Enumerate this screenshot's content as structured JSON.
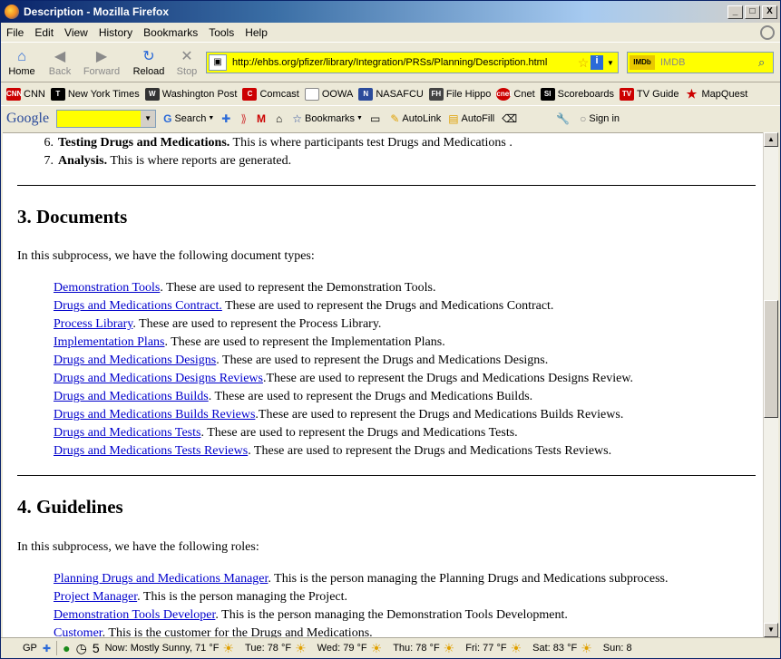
{
  "window": {
    "title": "Description - Mozilla Firefox",
    "min": "_",
    "max": "□",
    "close": "X"
  },
  "menu": [
    "File",
    "Edit",
    "View",
    "History",
    "Bookmarks",
    "Tools",
    "Help"
  ],
  "nav": {
    "back": "Back",
    "forward": "Forward",
    "home": "Home",
    "reload": "Reload",
    "stop": "Stop",
    "url": "http://ehbs.org/pfizer/library/Integration/PRSs/Planning/Description.html",
    "search_placeholder": "IMDB",
    "search_engine": "IMDb"
  },
  "bookmarks": [
    {
      "label": "CNN",
      "icon": "CNN",
      "color": "#cc0000"
    },
    {
      "label": "New York Times",
      "icon": "T",
      "color": "#000000"
    },
    {
      "label": "Washington Post",
      "icon": "W",
      "color": "#333333"
    },
    {
      "label": "Comcast",
      "icon": "C",
      "color": "#cc0000"
    },
    {
      "label": "OOWA",
      "icon": "",
      "color": "#ffffff"
    },
    {
      "label": "NASAFCU",
      "icon": "N",
      "color": "#2b4b9b"
    },
    {
      "label": "File Hippo",
      "icon": "FH",
      "color": "#444444"
    },
    {
      "label": "Cnet",
      "icon": "cnet",
      "color": "#cc0000"
    },
    {
      "label": "Scoreboards",
      "icon": "SI",
      "color": "#000000"
    },
    {
      "label": "TV Guide",
      "icon": "TV",
      "color": "#cc0000"
    },
    {
      "label": "MapQuest",
      "icon": "★",
      "color": "#cc0000"
    }
  ],
  "google_toolbar": {
    "logo": "Google",
    "search": "Search",
    "bookmarks": "Bookmarks",
    "autolink": "AutoLink",
    "autofill": "AutoFill",
    "signin": "Sign in"
  },
  "page": {
    "list_top": [
      {
        "num": "6.",
        "bold": "Testing Drugs and Medications.",
        "text": " This is where participants test Drugs and Medications ."
      },
      {
        "num": "7.",
        "bold": "Analysis.",
        "text": " This is where reports are generated."
      }
    ],
    "documents": {
      "heading": "3. Documents",
      "intro": "In this subprocess, we have the following document types:",
      "items": [
        {
          "link": "Demonstration Tools",
          "text": ". These are used to represent the Demonstration Tools."
        },
        {
          "link": "Drugs and Medications Contract.",
          "text": " These are used to represent the Drugs and Medications Contract."
        },
        {
          "link": "Process Library",
          "text": ". These are used to represent the Process Library."
        },
        {
          "link": "Implementation Plans",
          "text": ". These are used to represent the Implementation Plans."
        },
        {
          "link": "Drugs and Medications Designs",
          "text": ". These are used to represent the Drugs and Medications Designs."
        },
        {
          "link": "Drugs and Medications Designs Reviews",
          "text": ".These are used to represent the Drugs and Medications Designs Review."
        },
        {
          "link": "Drugs and Medications Builds",
          "text": ". These are used to represent the Drugs and Medications Builds."
        },
        {
          "link": "Drugs and Medications Builds Reviews",
          "text": ".These are used to represent the Drugs and Medications Builds Reviews."
        },
        {
          "link": "Drugs and Medications Tests",
          "text": ". These are used to represent the Drugs and Medications Tests."
        },
        {
          "link": "Drugs and Medications Tests Reviews",
          "text": ". These are used to represent the Drugs and Medications Tests Reviews."
        }
      ]
    },
    "guidelines": {
      "heading": "4. Guidelines",
      "intro": "In this subprocess, we have the following roles:",
      "items": [
        {
          "link": "Planning Drugs and Medications Manager",
          "text": ". This is the person managing the Planning Drugs and Medications subprocess."
        },
        {
          "link": "Project Manager",
          "text": ". This is the person managing the Project."
        },
        {
          "link": "Demonstration Tools Developer",
          "text": ". This is the person managing the Demonstration Tools Development."
        },
        {
          "link": "Customer",
          "text": ". This is the customer for the Drugs and Medications."
        }
      ]
    }
  },
  "status": {
    "gp": "GP",
    "five": "5",
    "weather": [
      "Now: Mostly Sunny, 71 °F",
      "Tue: 78 °F",
      "Wed: 79 °F",
      "Thu: 78 °F",
      "Fri: 77 °F",
      "Sat: 83 °F",
      "Sun: 8"
    ]
  }
}
